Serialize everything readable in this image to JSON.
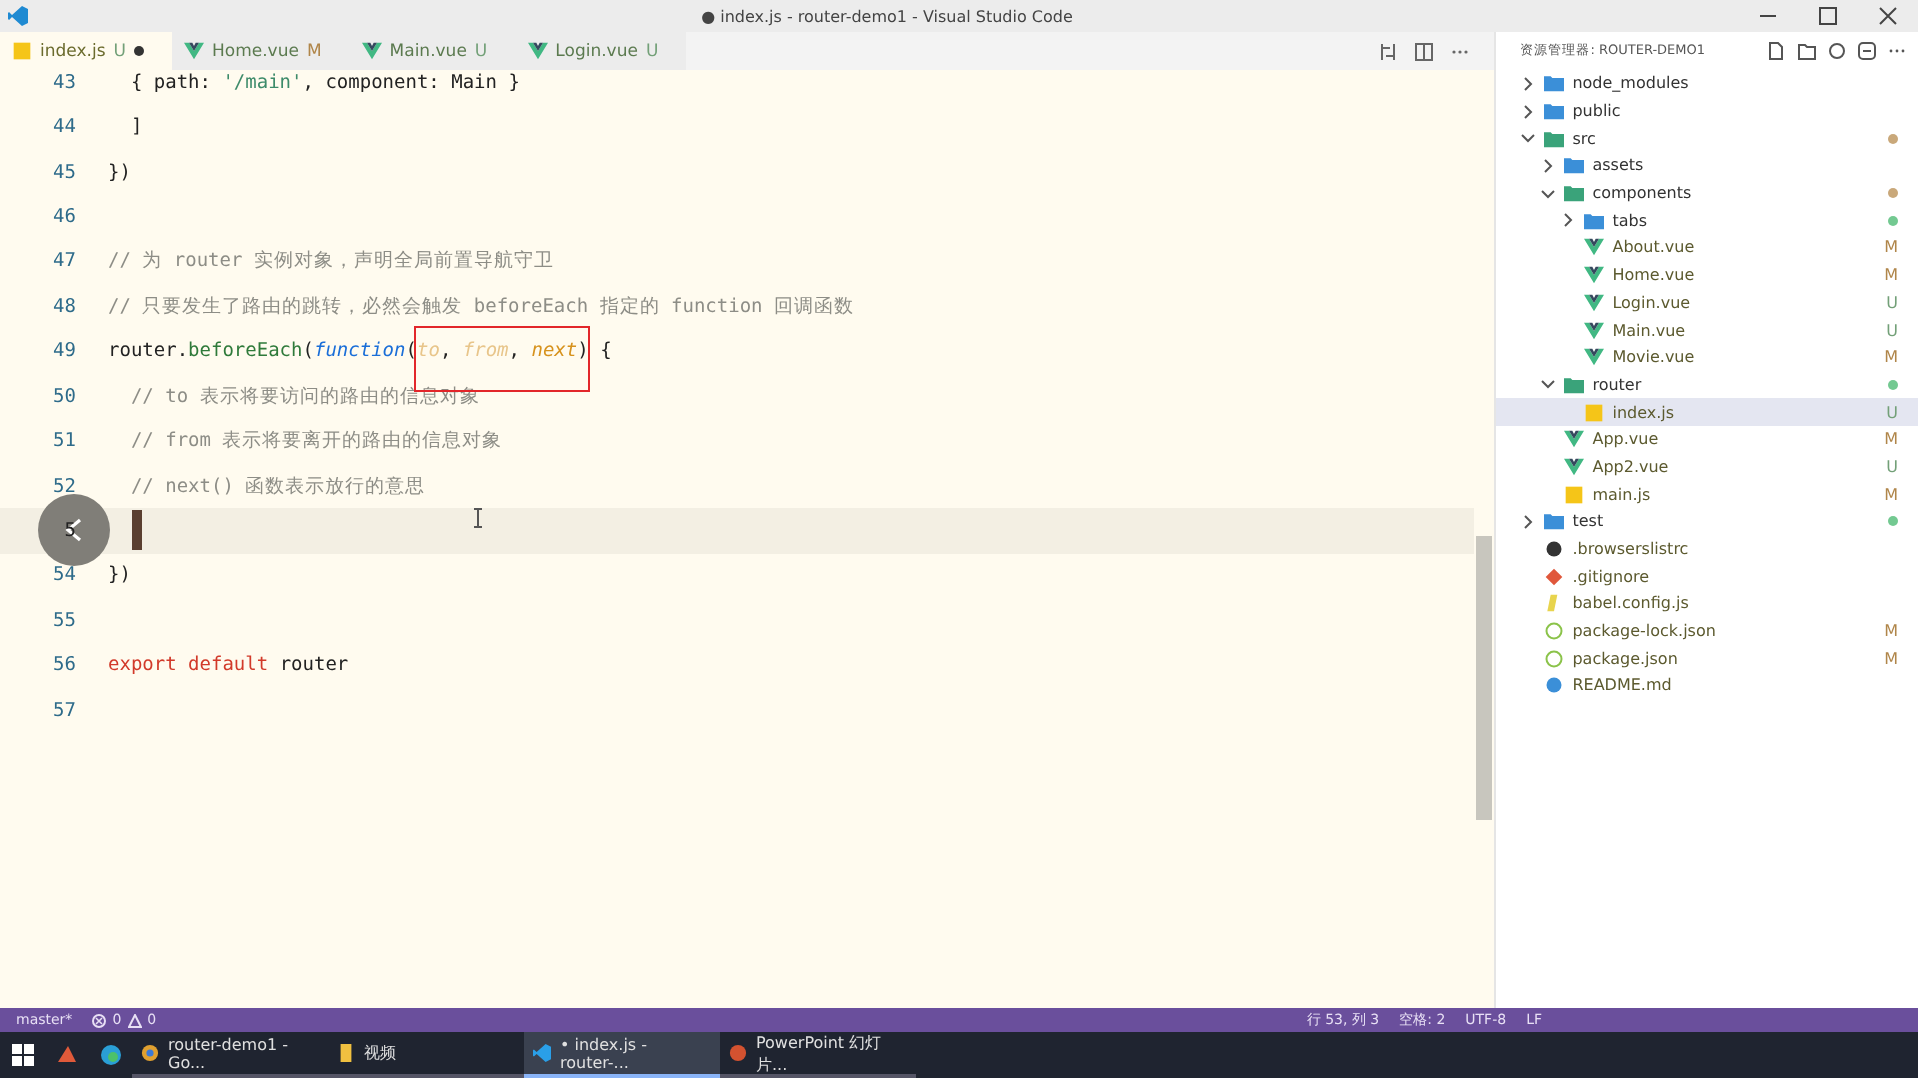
{
  "window": {
    "title": "● index.js - router-demo1 - Visual Studio Code"
  },
  "tabs": [
    {
      "label": "index.js",
      "status": "U",
      "kind": "js",
      "dirty": true,
      "selected": true
    },
    {
      "label": "Home.vue",
      "status": "M",
      "kind": "vue",
      "dirty": false,
      "selected": false
    },
    {
      "label": "Main.vue",
      "status": "U",
      "kind": "vue",
      "dirty": false,
      "selected": false
    },
    {
      "label": "Login.vue",
      "status": "U",
      "kind": "vue",
      "dirty": false,
      "selected": false
    }
  ],
  "editor": {
    "lines": [
      {
        "number": "43",
        "current": false,
        "tokens": [
          {
            "kind": "plain",
            "text": "  { path: "
          },
          {
            "kind": "string",
            "text": "'/main'"
          },
          {
            "kind": "plain",
            "text": ", component: Main }"
          }
        ]
      },
      {
        "number": "44",
        "current": false,
        "tokens": [
          {
            "kind": "plain",
            "text": "  ]"
          }
        ]
      },
      {
        "number": "45",
        "current": false,
        "tokens": [
          {
            "kind": "plain",
            "text": "})"
          }
        ]
      },
      {
        "number": "46",
        "current": false
      },
      {
        "number": "47",
        "current": false,
        "tokens": [
          {
            "kind": "comment",
            "text": "// 为 router 实例对象，声明全局前置导航守卫"
          }
        ]
      },
      {
        "number": "48",
        "current": false,
        "tokens": [
          {
            "kind": "comment",
            "text": "// 只要发生了路由的跳转，必然会触发 beforeEach 指定的 function 回调函数"
          }
        ]
      },
      {
        "number": "49",
        "current": false,
        "tokens": [
          {
            "kind": "plain",
            "text": "router."
          },
          {
            "kind": "method",
            "text": "beforeEach"
          },
          {
            "kind": "plain",
            "text": "("
          },
          {
            "kind": "keyword-italic",
            "text": "function"
          },
          {
            "kind": "plain",
            "text": "("
          },
          {
            "kind": "param-faded",
            "text": "to"
          },
          {
            "kind": "plain",
            "text": ", "
          },
          {
            "kind": "param-faded",
            "text": "from"
          },
          {
            "kind": "plain",
            "text": ", "
          },
          {
            "kind": "param",
            "text": "next"
          },
          {
            "kind": "plain",
            "text": ") {"
          }
        ]
      },
      {
        "number": "50",
        "current": false,
        "tokens": [
          {
            "kind": "comment",
            "text": "  // to 表示将要访问的路由的信息对象"
          }
        ]
      },
      {
        "number": "51",
        "current": false,
        "tokens": [
          {
            "kind": "comment",
            "text": "  // from 表示将要离开的路由的信息对象"
          }
        ]
      },
      {
        "number": "52",
        "current": false,
        "tokens": [
          {
            "kind": "comment",
            "text": "  // next() 函数表示放行的意思"
          }
        ]
      },
      {
        "number": "5",
        "current": true
      },
      {
        "number": "54",
        "current": false,
        "tokens": [
          {
            "kind": "plain",
            "text": "})"
          }
        ]
      },
      {
        "number": "55",
        "current": false
      },
      {
        "number": "56",
        "current": false,
        "tokens": [
          {
            "kind": "keyword",
            "text": "export"
          },
          {
            "kind": "keyword",
            "text": "default"
          },
          {
            "kind": "plain",
            "text": " router"
          }
        ]
      },
      {
        "number": "57",
        "current": false
      }
    ]
  },
  "explorer": {
    "title": "资源管理器: ROUTER-DEMO1",
    "items": [
      {
        "label": "node_modules",
        "kind": "folder",
        "expanded": false
      },
      {
        "label": "public",
        "kind": "folder",
        "expanded": false
      },
      {
        "label": "src",
        "kind": "folder",
        "expanded": true,
        "color": "#c9a87a",
        "children": [
          {
            "label": "assets",
            "kind": "folder",
            "expanded": false
          },
          {
            "label": "components",
            "kind": "folder",
            "expanded": true,
            "color": "#c9a87a",
            "children": [
              {
                "label": "tabs",
                "kind": "folder",
                "expanded": false,
                "color": "#73c991"
              },
              {
                "label": "About.vue",
                "kind": "vue",
                "status": "M"
              },
              {
                "label": "Home.vue",
                "kind": "vue",
                "status": "M"
              },
              {
                "label": "Login.vue",
                "kind": "vue",
                "status": "U"
              },
              {
                "label": "Main.vue",
                "kind": "vue",
                "status": "U"
              },
              {
                "label": "Movie.vue",
                "kind": "vue",
                "status": "M"
              }
            ]
          },
          {
            "label": "router",
            "kind": "folder",
            "expanded": true,
            "color": "#73c991",
            "children": [
              {
                "label": "index.js",
                "kind": "js",
                "status": "U",
                "selected": true
              }
            ]
          },
          {
            "label": "App.vue",
            "kind": "vue",
            "status": "M"
          },
          {
            "label": "App2.vue",
            "kind": "vue",
            "status": "U"
          },
          {
            "label": "main.js",
            "kind": "js",
            "status": "M"
          }
        ]
      },
      {
        "label": "test",
        "kind": "folder",
        "expanded": false,
        "color": "#73c991"
      },
      {
        "label": ".browserslistrc",
        "kind": "config"
      },
      {
        "label": ".gitignore",
        "kind": "git"
      },
      {
        "label": "babel.config.js",
        "kind": "babel"
      },
      {
        "label": "package-lock.json",
        "kind": "json",
        "status": "M"
      },
      {
        "label": "package.json",
        "kind": "json",
        "status": "M"
      },
      {
        "label": "README.md",
        "kind": "md"
      }
    ]
  },
  "status_bar": {
    "branch": "master*",
    "problems": "0",
    "warnings": "0",
    "position": "行 53, 列 3",
    "indent": "空格: 2",
    "encoding": "UTF-8",
    "eol": "LF"
  },
  "taskbar": {
    "items": [
      {
        "label": "router-demo1 - Go...",
        "kind": "browser",
        "selected": false
      },
      {
        "label": "视频",
        "kind": "folder",
        "selected": false
      },
      {
        "label": "• index.js - router-...",
        "kind": "vscode",
        "selected": true
      },
      {
        "label": "PowerPoint 幻灯片...",
        "kind": "ppt",
        "selected": false
      }
    ]
  }
}
